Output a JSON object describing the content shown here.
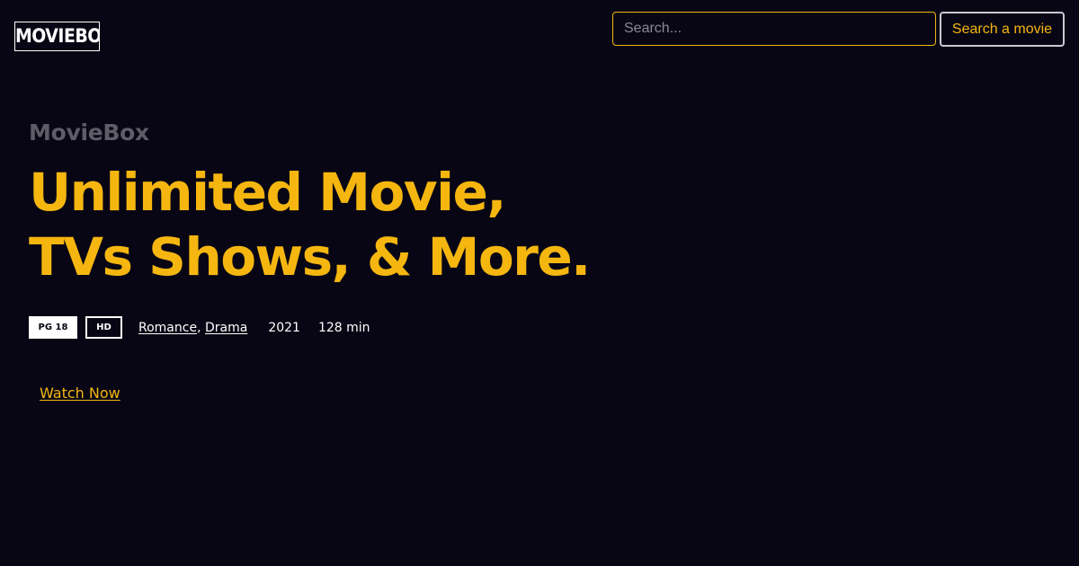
{
  "header": {
    "logo_text": "MOVIEBOX",
    "search_placeholder": "Search...",
    "search_value": "",
    "search_button_label": "Search a movie"
  },
  "hero": {
    "brand": "MovieBox",
    "headline_line1": "Unlimited Movie,",
    "headline_line2": "TVs Shows, & More.",
    "rating_badge": "PG 18",
    "quality_badge": "HD",
    "genres": [
      "Romance",
      "Drama"
    ],
    "genre_separator": ",",
    "year": "2021",
    "duration": "128 min",
    "cta_label": "Watch Now"
  },
  "colors": {
    "background": "#080614",
    "accent": "#f5b610",
    "muted_text": "#5e5c66",
    "text": "#ffffff",
    "button_border": "#c9c9d1"
  }
}
